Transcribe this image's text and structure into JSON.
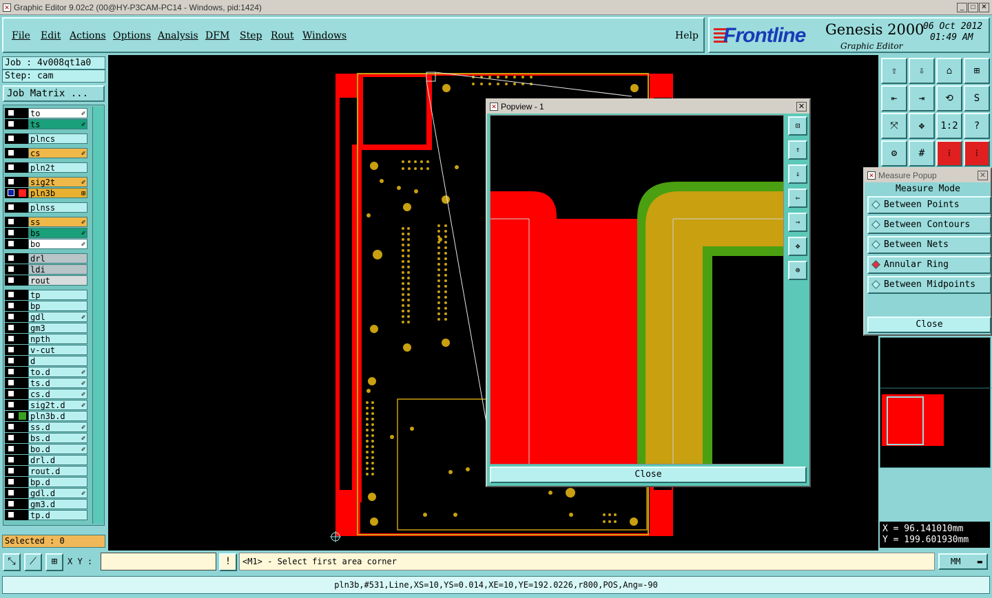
{
  "window": {
    "title": "Graphic Editor 9.02c2 (00@HY-P3CAM-PC14 - Windows, pid:1424)"
  },
  "menu": {
    "items": [
      "File",
      "Edit",
      "Actions",
      "Options",
      "Analysis",
      "DFM",
      "Step",
      "Rout",
      "Windows"
    ],
    "help": "Help"
  },
  "brand": {
    "logo": "Frontline",
    "product": "Genesis 2000",
    "subtitle": "Graphic Editor",
    "date": "06 Oct 2012",
    "time": "01:49 AM"
  },
  "job": {
    "job_label": "Job : 4v008qt1a0",
    "step_label": "Step: cam",
    "matrix_button": "Job Matrix ..."
  },
  "layers": [
    {
      "name": "to",
      "color": "#ffffff",
      "box": "white",
      "mark": "✐"
    },
    {
      "name": "ts",
      "color": "#1aa07a",
      "box": "white",
      "mark": "✐"
    },
    {
      "name": "plncs",
      "color": "#b8f0f0",
      "box": "white",
      "mark": ""
    },
    {
      "name": "cs",
      "color": "#f0b848",
      "box": "white",
      "mark": "✐"
    },
    {
      "name": "pln2t",
      "color": "#b8f0f0",
      "box": "white",
      "mark": ""
    },
    {
      "name": "sig2t",
      "color": "#f0b848",
      "box": "white",
      "mark": "✐"
    },
    {
      "name": "pln3b",
      "color": "#e8b030",
      "box": "blue",
      "mark": "⊞"
    },
    {
      "name": "plnss",
      "color": "#b8f0f0",
      "box": "white",
      "mark": ""
    },
    {
      "name": "ss",
      "color": "#f0b848",
      "box": "white",
      "mark": "✐"
    },
    {
      "name": "bs",
      "color": "#1aa07a",
      "box": "white",
      "mark": "✐"
    },
    {
      "name": "bo",
      "color": "#ffffff",
      "box": "white",
      "mark": "✐"
    },
    {
      "name": "drl",
      "color": "#b8c4c8",
      "box": "white",
      "mark": ""
    },
    {
      "name": "ldi",
      "color": "#b8c4c8",
      "box": "white",
      "mark": ""
    },
    {
      "name": "rout",
      "color": "#d8dcdc",
      "box": "white",
      "mark": ""
    },
    {
      "name": "tp",
      "color": "#b8f0f0",
      "box": "white",
      "mark": ""
    },
    {
      "name": "bp",
      "color": "#b8f0f0",
      "box": "white",
      "mark": ""
    },
    {
      "name": "gdl",
      "color": "#b8f0f0",
      "box": "white",
      "mark": "✐"
    },
    {
      "name": "gm3",
      "color": "#b8f0f0",
      "box": "white",
      "mark": ""
    },
    {
      "name": "npth",
      "color": "#b8f0f0",
      "box": "white",
      "mark": ""
    },
    {
      "name": "v-cut",
      "color": "#b8f0f0",
      "box": "white",
      "mark": ""
    },
    {
      "name": "d",
      "color": "#b8f0f0",
      "box": "white",
      "mark": ""
    },
    {
      "name": "to.d",
      "color": "#b8f0f0",
      "box": "white",
      "mark": "✐"
    },
    {
      "name": "ts.d",
      "color": "#b8f0f0",
      "box": "white",
      "mark": "✐"
    },
    {
      "name": "cs.d",
      "color": "#b8f0f0",
      "box": "white",
      "mark": "✐"
    },
    {
      "name": "sig2t.d",
      "color": "#b8f0f0",
      "box": "white",
      "mark": "✐"
    },
    {
      "name": "pln3b.d",
      "color": "#b8f0f0",
      "box": "green",
      "mark": ""
    },
    {
      "name": "ss.d",
      "color": "#b8f0f0",
      "box": "white",
      "mark": "✐"
    },
    {
      "name": "bs.d",
      "color": "#b8f0f0",
      "box": "white",
      "mark": "✐"
    },
    {
      "name": "bo.d",
      "color": "#b8f0f0",
      "box": "white",
      "mark": "✐"
    },
    {
      "name": "drl.d",
      "color": "#b8f0f0",
      "box": "white",
      "mark": ""
    },
    {
      "name": "rout.d",
      "color": "#b8f0f0",
      "box": "white",
      "mark": ""
    },
    {
      "name": "bp.d",
      "color": "#b8f0f0",
      "box": "white",
      "mark": ""
    },
    {
      "name": "gdl.d",
      "color": "#b8f0f0",
      "box": "white",
      "mark": "✐"
    },
    {
      "name": "gm3.d",
      "color": "#b8f0f0",
      "box": "white",
      "mark": ""
    },
    {
      "name": "tp.d",
      "color": "#b8f0f0",
      "box": "white",
      "mark": ""
    }
  ],
  "selected": "Selected : 0",
  "popview": {
    "title": "Popview - 1",
    "close": "Close"
  },
  "measure": {
    "title": "Measure Popup",
    "heading": "Measure Mode",
    "options": [
      {
        "label": "Between Points",
        "on": false
      },
      {
        "label": "Between Contours",
        "on": false
      },
      {
        "label": "Between Nets",
        "on": false
      },
      {
        "label": "Annular Ring",
        "on": true
      },
      {
        "label": "Between Midpoints",
        "on": false
      }
    ],
    "close": "Close"
  },
  "toolbar": {
    "zoom_label": "1:2",
    "help_label": "?"
  },
  "coords": {
    "x": "X =  96.141010mm",
    "y": "Y = 199.601930mm"
  },
  "bottom": {
    "xy_label": "X Y :",
    "prompt": "<M1> - Select first area corner",
    "units": "MM",
    "status": "pln3b,#531,Line,XS=10,YS=0.014,XE=10,YE=192.0226,r800,POS,Ang=-90"
  },
  "colors": {
    "panel": "#8fd5d5",
    "copper": "#c8a010",
    "plane": "#ff0000",
    "mask": "#4aa010"
  }
}
